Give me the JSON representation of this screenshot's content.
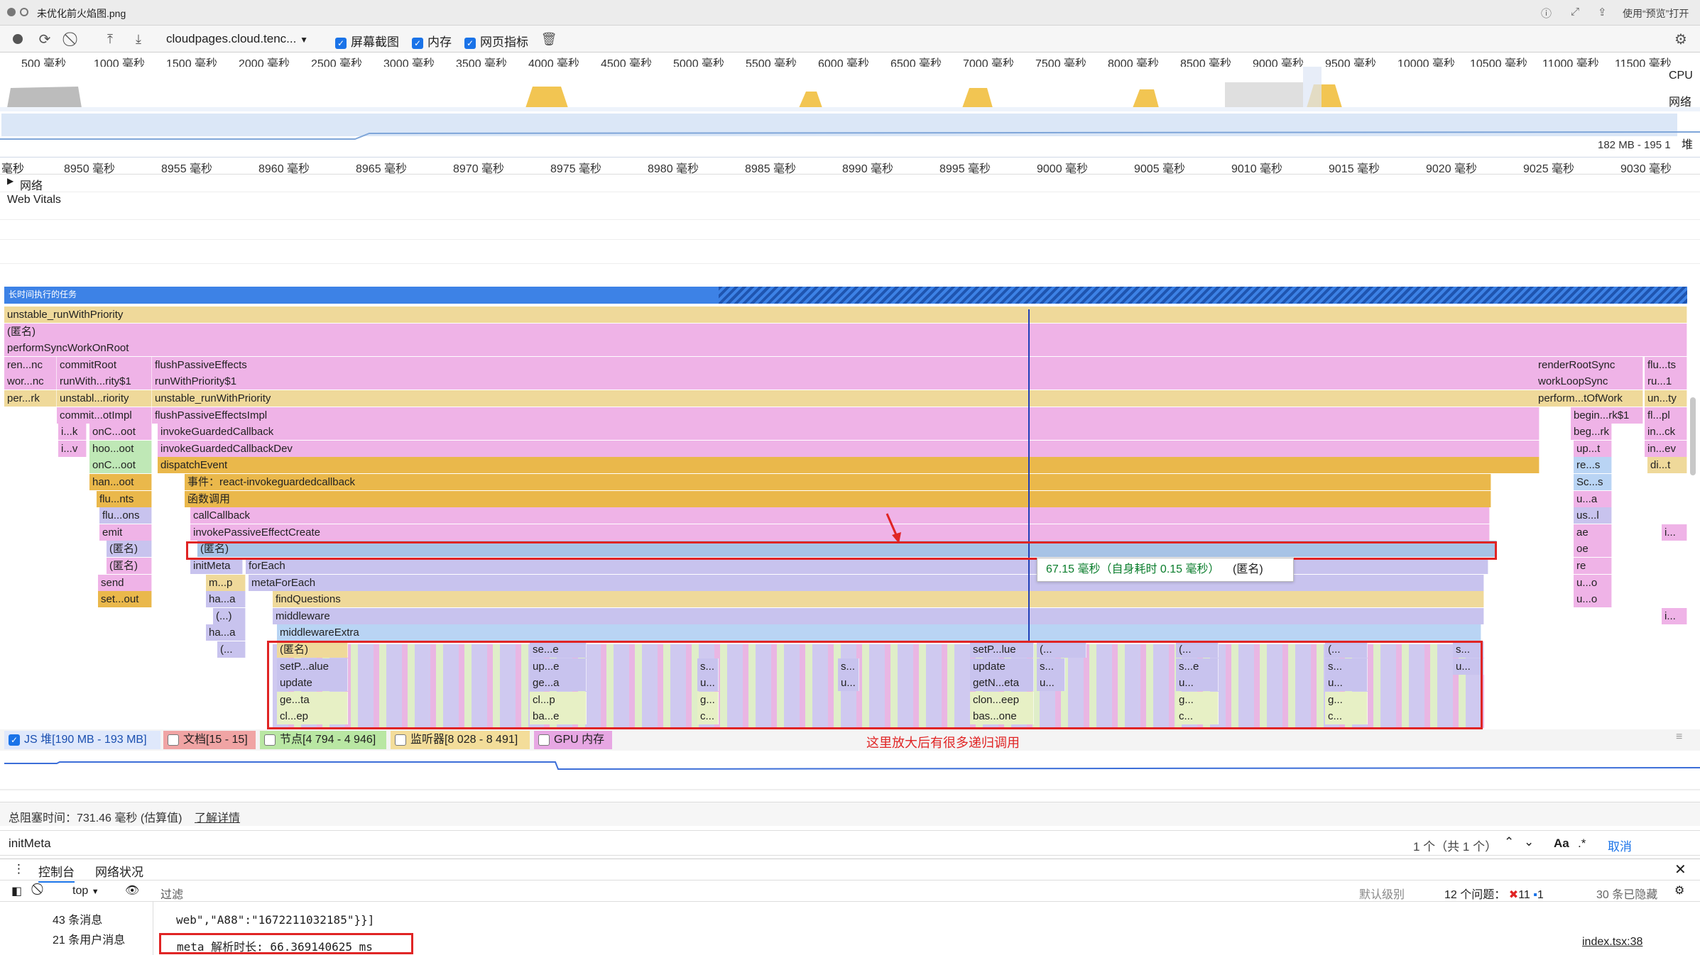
{
  "window": {
    "title": "未优化前火焰图.png",
    "open_with": "使用“预览”打开"
  },
  "toolbar": {
    "url": "cloudpages.cloud.tenc...",
    "screenshots": "屏幕截图",
    "memory": "内存",
    "web_metrics": "网页指标"
  },
  "overview": {
    "ticks": [
      "500 毫秒",
      "1000 毫秒",
      "1500 毫秒",
      "2000 毫秒",
      "2500 毫秒",
      "3000 毫秒",
      "3500 毫秒",
      "4000 毫秒",
      "4500 毫秒",
      "5000 毫秒",
      "5500 毫秒",
      "6000 毫秒",
      "6500 毫秒",
      "7000 毫秒",
      "7500 毫秒",
      "8000 毫秒",
      "8500 毫秒",
      "9000 毫秒",
      "9500 毫秒",
      "10000 毫秒",
      "10500 毫秒",
      "11000 毫秒",
      "11500 毫秒"
    ],
    "cpu_label": "CPU",
    "net_label": "网络",
    "heap_label": "堆",
    "heap_range": "182 MB - 195 1"
  },
  "detail_ruler": {
    "left_cut": "毫秒",
    "ticks": [
      "8950 毫秒",
      "8955 毫秒",
      "8960 毫秒",
      "8965 毫秒",
      "8970 毫秒",
      "8975 毫秒",
      "8980 毫秒",
      "8985 毫秒",
      "8990 毫秒",
      "8995 毫秒",
      "9000 毫秒",
      "9005 毫秒",
      "9010 毫秒",
      "9015 毫秒",
      "9020 毫秒",
      "9025 毫秒",
      "9030 毫秒"
    ]
  },
  "tracks": {
    "network": "网络",
    "web_vitals": "Web Vitals",
    "long_task": "长时间执行的任务"
  },
  "flame": {
    "rows": [
      [
        "unstable_runWithPriority"
      ],
      [
        "(匿名)"
      ],
      [
        "performSyncWorkOnRoot"
      ],
      [
        "ren...nc",
        "commitRoot",
        "flushPassiveEffects",
        "renderRootSync",
        "flu...ts"
      ],
      [
        "wor...nc",
        "runWith...rity$1",
        "runWithPriority$1",
        "workLoopSync",
        "ru...1"
      ],
      [
        "per...rk",
        "unstabl...riority",
        "unstable_runWithPriority",
        "perform...tOfWork",
        "un...ty"
      ],
      [
        "commit...otImpl",
        "flushPassiveEffectsImpl",
        "begin...rk$1",
        "fl...pl"
      ],
      [
        "i...k",
        "onC...oot",
        "invokeGuardedCallback",
        "beg...rk",
        "in...ck"
      ],
      [
        "i...v",
        "hoo...oot",
        "invokeGuardedCallbackDev",
        "up...t",
        "in...ev"
      ],
      [
        "onC...oot",
        "dispatchEvent",
        "re...s",
        "di...t"
      ],
      [
        "han...oot",
        "事件：react-invokeguardedcallback",
        "Sc...s"
      ],
      [
        "flu...nts",
        "函数调用",
        "u...a"
      ],
      [
        "flu...ons",
        "callCallback",
        "us...l"
      ],
      [
        "emit",
        "invokePassiveEffectCreate",
        "ae",
        "i..."
      ],
      [
        "(匿名)",
        "(匿名)",
        "oe"
      ],
      [
        "(匿名)",
        "initMeta",
        "forEach",
        "re"
      ],
      [
        "send",
        "m...p",
        "metaForEach",
        "u...o"
      ],
      [
        "set...out",
        "ha...a",
        "findQuestions",
        "u...o"
      ],
      [
        "(...)",
        "middleware",
        "i..."
      ],
      [
        "ha...a",
        "middlewareExtra"
      ],
      [
        "(...",
        "(匿名)",
        "se...e",
        "setP...lue",
        "(...",
        "(...",
        "(...",
        "s..."
      ],
      [
        "setP...alue",
        "up...e",
        "s...",
        "s...",
        "update",
        "s...",
        "s...e",
        "s...",
        "u..."
      ],
      [
        "update",
        "ge...a",
        "u...",
        "u...",
        "getN...eta",
        "u...",
        "u...",
        "u..."
      ],
      [
        "ge...ta",
        "cl...p",
        "g...",
        "clon...eep",
        "g...",
        "g..."
      ],
      [
        "cl...ep",
        "ba...e",
        "c...",
        "bas...one",
        "c...",
        "c..."
      ]
    ],
    "tooltip": {
      "time": "67.15 毫秒（自身耗时 0.15 毫秒）",
      "name": "(匿名)"
    },
    "annotation": "这里放大后有很多递归调用"
  },
  "counters": {
    "js_heap": "JS 堆[190 MB - 193 MB]",
    "documents": "文档[15 - 15]",
    "nodes": "节点[4 794 - 4 946]",
    "listeners": "监听器[8 028 - 8 491]",
    "gpu": "GPU 内存"
  },
  "summary": {
    "total_blocking": "总阻塞时间：731.46 毫秒 (估算值)",
    "learn_more": "了解详情"
  },
  "search": {
    "query": "initMeta",
    "count": "1 个（共 1 个）",
    "match_case": "Aa",
    "regex": ".*",
    "cancel": "取消"
  },
  "drawer": {
    "tabs": [
      "控制台",
      "网络状况"
    ],
    "context": "top",
    "filter_placeholder": "过滤",
    "level": "默认级别",
    "issues": "12 个问题：",
    "errors": "11",
    "infos": "1",
    "hidden": "30 条已隐藏",
    "sidebar": [
      "43 条消息",
      "21 条用户消息"
    ],
    "log_prev": "web\",\"A88\":\"1672211032185\"}}]",
    "log_line": "meta 解析时长: 66.369140625 ms",
    "source": "index.tsx:38"
  },
  "colors": {
    "accent": "#1a73e8",
    "highlight": "#e02424",
    "scripting": "#efb3e7",
    "rendering": "#c8c3ee",
    "event": "#eab84b"
  }
}
